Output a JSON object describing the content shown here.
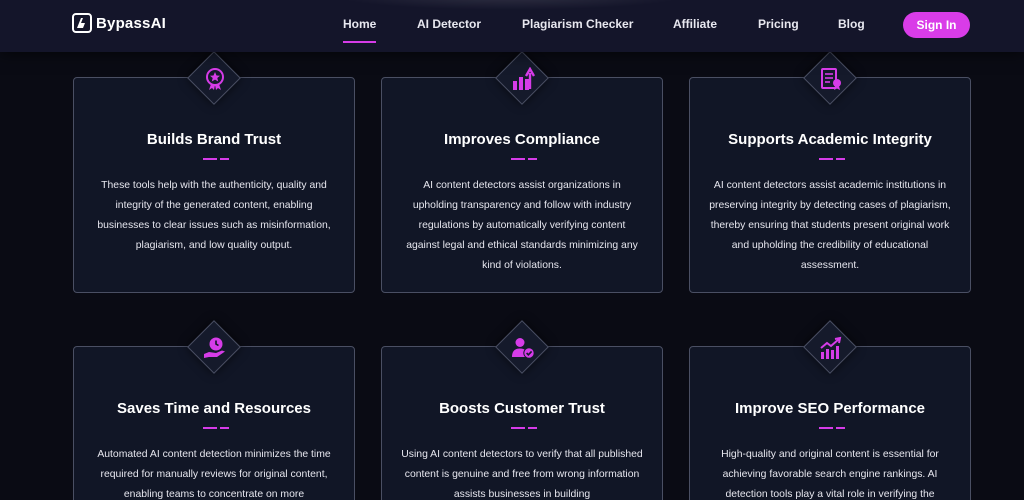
{
  "header": {
    "logo_text": "BypassAI",
    "nav": [
      "Home",
      "AI Detector",
      "Plagiarism Checker",
      "Affiliate",
      "Pricing",
      "Blog"
    ],
    "active": "Home",
    "signin_label": "Sign In"
  },
  "colors": {
    "accent": "#d63ce8",
    "background": "#0a0b14",
    "card": "#111626",
    "border": "#4a4f63"
  },
  "cards": [
    {
      "icon": "award-badge-icon",
      "title": "Builds Brand Trust",
      "desc": "These tools help with the authenticity, quality and integrity of the generated content, enabling businesses to clear issues such as misinformation, plagiarism, and low quality output."
    },
    {
      "icon": "growth-chart-icon",
      "title": "Improves Compliance",
      "desc": "AI content detectors assist organizations in upholding transparency and follow with industry regulations by automatically verifying content against legal and ethical standards minimizing any kind of violations."
    },
    {
      "icon": "document-certificate-icon",
      "title": "Supports Academic Integrity",
      "desc": "AI content detectors assist academic institutions in preserving integrity by detecting cases of plagiarism, thereby ensuring that students present original work and upholding the credibility of educational assessment."
    },
    {
      "icon": "clock-hand-icon",
      "title": "Saves Time and Resources",
      "desc": "Automated AI content detection minimizes the time required for manually reviews for original content, enabling teams to concentrate on more"
    },
    {
      "icon": "user-check-icon",
      "title": "Boosts Customer Trust",
      "desc": "Using AI content detectors to verify that all published content is genuine and free from wrong information assists businesses in building"
    },
    {
      "icon": "seo-growth-icon",
      "title": "Improve SEO Performance",
      "desc": "High-quality and original content is essential for achieving favorable search engine rankings. AI detection tools play a vital role in verifying the"
    }
  ]
}
